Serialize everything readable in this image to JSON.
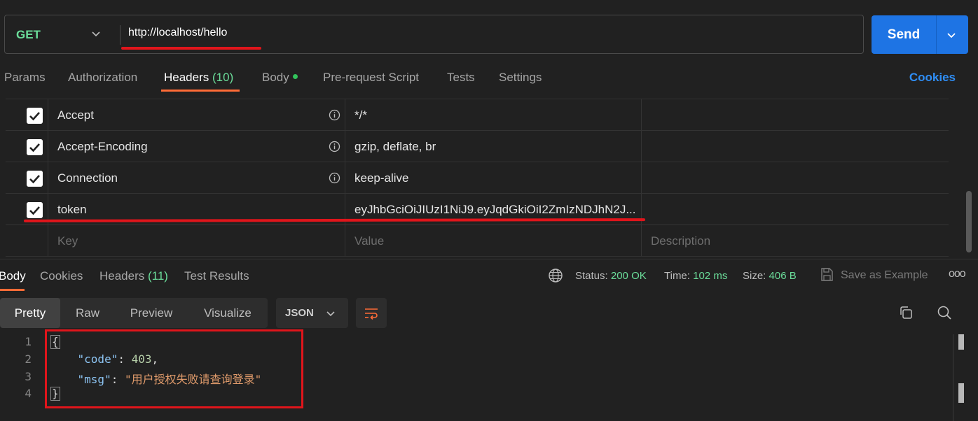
{
  "request": {
    "method": "GET",
    "url": "http://localhost/hello",
    "send_label": "Send"
  },
  "req_tabs": {
    "params": "Params",
    "authorization": "Authorization",
    "headers": "Headers",
    "headers_count": "(10)",
    "body": "Body",
    "prerequest": "Pre-request Script",
    "tests": "Tests",
    "settings": "Settings",
    "cookies": "Cookies"
  },
  "headers_table": {
    "rows": [
      {
        "key": "Accept",
        "value": "*/*"
      },
      {
        "key": "Accept-Encoding",
        "value": "gzip, deflate, br"
      },
      {
        "key": "Connection",
        "value": "keep-alive"
      },
      {
        "key": "token",
        "value": "eyJhbGciOiJIUzI1NiJ9.eyJqdGkiOiI2ZmIzNDJhN2J..."
      }
    ],
    "placeholders": {
      "key": "Key",
      "value": "Value",
      "description": "Description"
    }
  },
  "response": {
    "tabs": {
      "body": "Body",
      "cookies": "Cookies",
      "headers": "Headers",
      "headers_count": "(11)",
      "test_results": "Test Results"
    },
    "status_label": "Status:",
    "status_value": "200 OK",
    "time_label": "Time:",
    "time_value": "102 ms",
    "size_label": "Size:",
    "size_value": "406 B",
    "save_example": "Save as Example",
    "more": "ooo"
  },
  "viewer": {
    "views": [
      "Pretty",
      "Raw",
      "Preview",
      "Visualize"
    ],
    "format": "JSON"
  },
  "code": {
    "line_numbers": [
      "1",
      "2",
      "3",
      "4"
    ],
    "open_brace": "{",
    "close_brace": "}",
    "code_key": "\"code\"",
    "code_value": "403",
    "msg_key": "\"msg\"",
    "msg_value": "\"用户授权失败请查询登录\""
  },
  "colors": {
    "accent": "#ff6c37",
    "send": "#1e74e4",
    "success": "#6bdd9a",
    "highlight": "#e0151b"
  }
}
